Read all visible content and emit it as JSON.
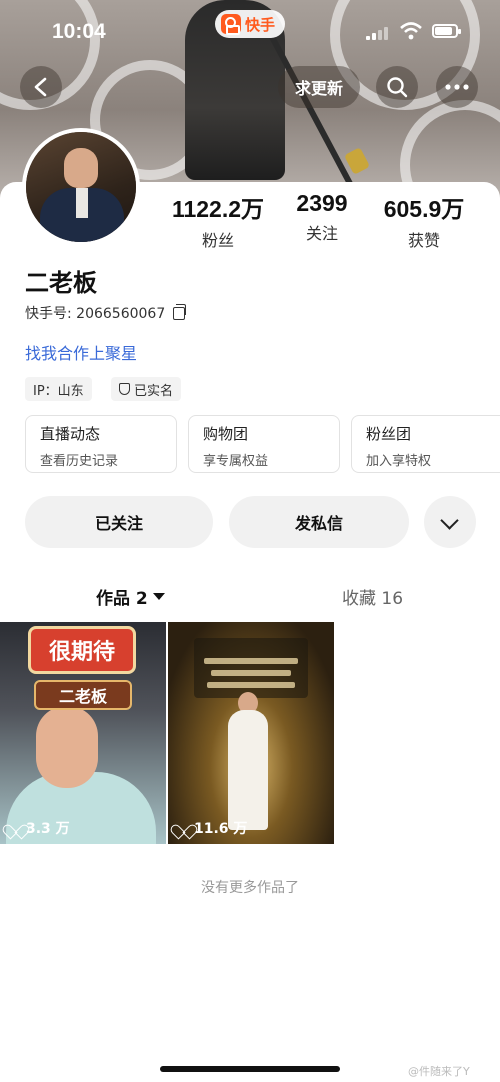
{
  "status_bar": {
    "time": "10:04",
    "app_name": "快手"
  },
  "nav": {
    "update_request": "求更新",
    "back_icon": "chevron-left-icon",
    "search_icon": "search-icon",
    "more_icon": "more-dots-icon"
  },
  "stats": [
    {
      "value": "1122.2万",
      "label": "粉丝"
    },
    {
      "value": "2399",
      "label": "关注"
    },
    {
      "value": "605.9万",
      "label": "获赞"
    }
  ],
  "profile": {
    "name": "二老板",
    "kuaishou_id": "快手号: 2066560067",
    "collab_link": "找我合作上聚星",
    "tags": [
      "IP：山东",
      "已实名"
    ]
  },
  "features": [
    {
      "title": "直播动态",
      "subtitle": "查看历史记录"
    },
    {
      "title": "购物团",
      "subtitle": "享专属权益"
    },
    {
      "title": "粉丝团",
      "subtitle": "加入享特权"
    }
  ],
  "actions": {
    "followed": "已关注",
    "message": "发私信"
  },
  "tabs": {
    "works": "作品 2",
    "favorites": "收藏 16"
  },
  "videos": [
    {
      "banner": "很期待",
      "name_tag": "二老板",
      "likes": "3.3 万"
    },
    {
      "likes": "11.6 万"
    }
  ],
  "footer": {
    "no_more": "没有更多作品了",
    "watermark": "@件随来了Y"
  },
  "colors": {
    "accent": "#ff5a1e",
    "link": "#3a6ad8"
  }
}
